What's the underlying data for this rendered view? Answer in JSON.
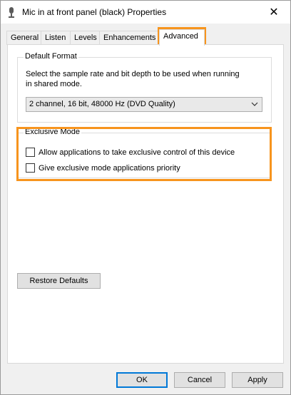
{
  "window": {
    "title": "Mic in at front panel (black) Properties",
    "close_symbol": "✕"
  },
  "tabs": [
    {
      "label": "General"
    },
    {
      "label": "Listen"
    },
    {
      "label": "Levels"
    },
    {
      "label": "Enhancements"
    },
    {
      "label": "Advanced"
    }
  ],
  "active_tab": "Advanced",
  "default_format": {
    "title": "Default Format",
    "description_line1": "Select the sample rate and bit depth to be used when running",
    "description_line2": "in shared mode.",
    "selected_value": "2 channel, 16 bit, 48000 Hz (DVD Quality)"
  },
  "exclusive_mode": {
    "title": "Exclusive Mode",
    "options": [
      {
        "label": "Allow applications to take exclusive control of this device",
        "checked": false
      },
      {
        "label": "Give exclusive mode applications priority",
        "checked": false
      }
    ]
  },
  "buttons": {
    "restore_defaults": "Restore Defaults",
    "ok": "OK",
    "cancel": "Cancel",
    "apply": "Apply"
  },
  "colors": {
    "highlight": "#f7941d",
    "primary_border": "#0078d7"
  },
  "icons": {
    "title": "microphone-icon",
    "dropdown": "chevron-down-icon"
  }
}
